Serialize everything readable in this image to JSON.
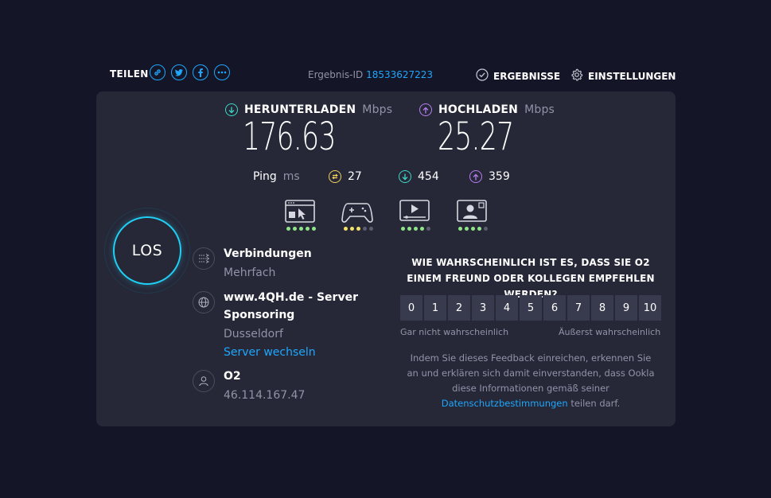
{
  "topbar": {
    "share_label": "TEILEN",
    "share_icons": [
      "link-icon",
      "twitter-icon",
      "facebook-icon",
      "more-icon"
    ],
    "result_id_label": "Ergebnis-ID",
    "result_id": "18533627223",
    "results_label": "ERGEBNISSE",
    "settings_label": "EINSTELLUNGEN"
  },
  "download": {
    "label": "HERUNTERLADEN",
    "unit": "Mbps",
    "value": "176.63"
  },
  "upload": {
    "label": "HOCHLADEN",
    "unit": "Mbps",
    "value": "25.27"
  },
  "ping": {
    "label": "Ping",
    "unit": "ms",
    "idle": "27",
    "download": "454",
    "upload": "359"
  },
  "categories": [
    {
      "icon": "web-browsing-icon",
      "rating": 5,
      "dot_color": "#8fe388"
    },
    {
      "icon": "gaming-icon",
      "rating": 3,
      "dot_color": "#f5e06a"
    },
    {
      "icon": "video-streaming-icon",
      "rating": 4,
      "dot_color": "#8fe388"
    },
    {
      "icon": "video-chat-icon",
      "rating": 4,
      "dot_color": "#8fe388"
    }
  ],
  "go_button": {
    "label": "LOS"
  },
  "connection": {
    "title": "Verbindungen",
    "value": "Mehrfach"
  },
  "server": {
    "title_line1": "www.4QH.de - Server",
    "title_line2": "Sponsoring",
    "location": "Dusseldorf",
    "change_link": "Server wechseln"
  },
  "provider": {
    "name": "O2",
    "ip": "46.114.167.47"
  },
  "survey": {
    "question": "WIE WAHRSCHEINLICH IST ES, DASS SIE O2 EINEM FREUND ODER KOLLEGEN EMPFEHLEN WERDEN?",
    "scale": [
      "0",
      "1",
      "2",
      "3",
      "4",
      "5",
      "6",
      "7",
      "8",
      "9",
      "10"
    ],
    "low_label": "Gar nicht wahrscheinlich",
    "high_label": "Äußerst wahrscheinlich",
    "note_line1": "Indem Sie dieses Feedback einreichen, erkennen Sie",
    "note_line2": "an und erklären sich damit einverstanden, dass Ookla",
    "note_line3": "diese Informationen gemäß seiner",
    "note_link": "Datenschutzbestimmungen",
    "note_tail": " teilen darf."
  },
  "colors": {
    "background": "#141526",
    "panel": "#262838",
    "accent_blue": "#1ea7fd",
    "download_cyan": "#3ed8c6",
    "upload_purple": "#b77ef0",
    "ping_yellow": "#f2d35a",
    "go_ring": "#1fd0f4"
  }
}
